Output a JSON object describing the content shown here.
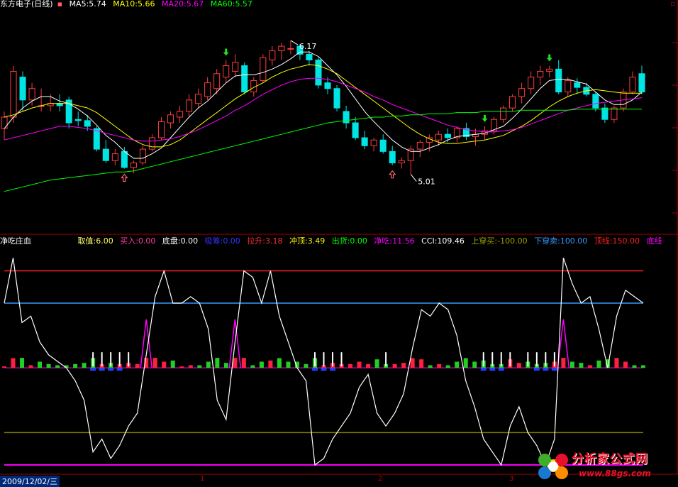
{
  "top_legend": {
    "title": "东方电子(日线)",
    "items": [
      {
        "label": "MA5:5.74",
        "color": "#ffffff"
      },
      {
        "label": "MA10:5.66",
        "color": "#ffff00"
      },
      {
        "label": "MA20:5.67",
        "color": "#ff00ff"
      },
      {
        "label": "MA60:5.57",
        "color": "#00ff00"
      }
    ]
  },
  "indicator_legend": {
    "title": "净吃庄血",
    "items": [
      {
        "label": "取值:6.00",
        "color": "#ffff66"
      },
      {
        "label": "买入:0.00",
        "color": "#ff3fa0"
      },
      {
        "label": "底盘:0.00",
        "color": "#ffffff"
      },
      {
        "label": "吸筹:0.00",
        "color": "#3333ff"
      },
      {
        "label": "拉升:3.18",
        "color": "#ff3030"
      },
      {
        "label": "冲顶:3.49",
        "color": "#ffff00"
      },
      {
        "label": "出货:0.00",
        "color": "#00ff00"
      },
      {
        "label": "净吃:11.56",
        "color": "#ff00ff"
      },
      {
        "label": "CCI:109.46",
        "color": "#ffffff"
      },
      {
        "label": "上穿买:-100.00",
        "color": "#808000"
      },
      {
        "label": "下穿卖:100.00",
        "color": "#3399ff"
      },
      {
        "label": "顶线:150.00",
        "color": "#ff2020"
      },
      {
        "label": "底线",
        "color": "#ff00ff"
      }
    ]
  },
  "footer": {
    "date": "2009/12/02/三",
    "month_marks": [
      "1",
      "2",
      "3"
    ]
  },
  "logo": {
    "name": "分析家公式网",
    "url": "www.88gs.com"
  },
  "chart_data": [
    {
      "type": "candlestick",
      "title": "东方电子(日线)",
      "annotations": [
        {
          "label": "6.17",
          "kind": "high"
        },
        {
          "label": "5.01",
          "kind": "low"
        }
      ],
      "ylim": [
        4.6,
        6.4
      ],
      "candles": [
        [
          5.4,
          5.55,
          5.3,
          5.5
        ],
        [
          5.5,
          5.95,
          5.45,
          5.9
        ],
        [
          5.85,
          5.9,
          5.55,
          5.65
        ],
        [
          5.65,
          5.8,
          5.6,
          5.75
        ],
        [
          5.6,
          5.75,
          5.55,
          5.6
        ],
        [
          5.6,
          5.7,
          5.55,
          5.62
        ],
        [
          5.62,
          5.7,
          5.55,
          5.6
        ],
        [
          5.65,
          5.68,
          5.4,
          5.45
        ],
        [
          5.48,
          5.55,
          5.42,
          5.47
        ],
        [
          5.47,
          5.52,
          5.38,
          5.42
        ],
        [
          5.4,
          5.42,
          5.2,
          5.22
        ],
        [
          5.22,
          5.3,
          5.1,
          5.12
        ],
        [
          5.12,
          5.22,
          5.08,
          5.18
        ],
        [
          5.2,
          5.24,
          5.05,
          5.06
        ],
        [
          5.06,
          5.12,
          5.01,
          5.1
        ],
        [
          5.1,
          5.25,
          5.08,
          5.22
        ],
        [
          5.22,
          5.35,
          5.2,
          5.32
        ],
        [
          5.32,
          5.5,
          5.3,
          5.46
        ],
        [
          5.45,
          5.55,
          5.4,
          5.52
        ],
        [
          5.5,
          5.6,
          5.45,
          5.55
        ],
        [
          5.55,
          5.7,
          5.5,
          5.65
        ],
        [
          5.62,
          5.75,
          5.58,
          5.7
        ],
        [
          5.68,
          5.85,
          5.65,
          5.8
        ],
        [
          5.75,
          5.92,
          5.7,
          5.88
        ],
        [
          5.85,
          6.0,
          5.8,
          5.95
        ],
        [
          5.9,
          6.05,
          5.85,
          5.98
        ],
        [
          5.95,
          5.98,
          5.7,
          5.72
        ],
        [
          5.72,
          5.85,
          5.68,
          5.82
        ],
        [
          5.82,
          6.05,
          5.8,
          6.02
        ],
        [
          6.0,
          6.12,
          5.95,
          6.08
        ],
        [
          6.08,
          6.15,
          6.0,
          6.12
        ],
        [
          6.1,
          6.17,
          6.05,
          6.1
        ],
        [
          6.12,
          6.14,
          6.0,
          6.05
        ],
        [
          6.05,
          6.08,
          5.95,
          6.0
        ],
        [
          6.0,
          6.02,
          5.75,
          5.78
        ],
        [
          5.8,
          5.85,
          5.7,
          5.75
        ],
        [
          5.75,
          5.78,
          5.55,
          5.58
        ],
        [
          5.55,
          5.6,
          5.4,
          5.45
        ],
        [
          5.45,
          5.5,
          5.3,
          5.32
        ],
        [
          5.32,
          5.38,
          5.22,
          5.25
        ],
        [
          5.25,
          5.32,
          5.2,
          5.3
        ],
        [
          5.3,
          5.35,
          5.18,
          5.2
        ],
        [
          5.2,
          5.25,
          5.08,
          5.1
        ],
        [
          5.1,
          5.15,
          5.05,
          5.12
        ],
        [
          5.12,
          5.25,
          5.0,
          5.22
        ],
        [
          5.22,
          5.3,
          5.15,
          5.28
        ],
        [
          5.28,
          5.35,
          5.2,
          5.32
        ],
        [
          5.3,
          5.38,
          5.25,
          5.35
        ],
        [
          5.35,
          5.4,
          5.28,
          5.32
        ],
        [
          5.32,
          5.42,
          5.28,
          5.4
        ],
        [
          5.4,
          5.45,
          5.3,
          5.33
        ],
        [
          5.33,
          5.4,
          5.25,
          5.35
        ],
        [
          5.35,
          5.42,
          5.3,
          5.38
        ],
        [
          5.38,
          5.5,
          5.35,
          5.48
        ],
        [
          5.48,
          5.6,
          5.45,
          5.58
        ],
        [
          5.58,
          5.7,
          5.55,
          5.68
        ],
        [
          5.68,
          5.8,
          5.62,
          5.75
        ],
        [
          5.75,
          5.9,
          5.7,
          5.85
        ],
        [
          5.85,
          5.95,
          5.78,
          5.9
        ],
        [
          5.9,
          5.95,
          5.85,
          5.92
        ],
        [
          5.92,
          6.0,
          5.7,
          5.72
        ],
        [
          5.72,
          5.85,
          5.68,
          5.82
        ],
        [
          5.8,
          5.84,
          5.7,
          5.76
        ],
        [
          5.76,
          5.8,
          5.68,
          5.7
        ],
        [
          5.7,
          5.72,
          5.55,
          5.58
        ],
        [
          5.58,
          5.62,
          5.45,
          5.48
        ],
        [
          5.48,
          5.6,
          5.45,
          5.58
        ],
        [
          5.58,
          5.75,
          5.55,
          5.72
        ],
        [
          5.72,
          5.9,
          5.7,
          5.85
        ],
        [
          5.88,
          5.95,
          5.7,
          5.72
        ]
      ],
      "ma": [
        {
          "name": "MA5",
          "color": "#ffffff",
          "values": [
            5.4,
            5.5,
            5.58,
            5.64,
            5.68,
            5.68,
            5.64,
            5.62,
            5.57,
            5.51,
            5.43,
            5.34,
            5.28,
            5.2,
            5.14,
            5.14,
            5.18,
            5.23,
            5.32,
            5.41,
            5.5,
            5.58,
            5.64,
            5.72,
            5.8,
            5.86,
            5.87,
            5.87,
            5.89,
            5.92,
            5.96,
            6.01,
            6.07,
            6.07,
            6.03,
            5.95,
            5.87,
            5.77,
            5.66,
            5.55,
            5.46,
            5.38,
            5.3,
            5.24,
            5.2,
            5.2,
            5.23,
            5.26,
            5.3,
            5.33,
            5.34,
            5.35,
            5.36,
            5.39,
            5.42,
            5.49,
            5.57,
            5.66,
            5.75,
            5.82,
            5.83,
            5.83,
            5.81,
            5.79,
            5.72,
            5.65,
            5.61,
            5.61,
            5.65,
            5.72
          ]
        },
        {
          "name": "MA10",
          "color": "#ffff00",
          "values": [
            5.5,
            5.52,
            5.55,
            5.58,
            5.6,
            5.62,
            5.62,
            5.62,
            5.6,
            5.58,
            5.54,
            5.48,
            5.42,
            5.36,
            5.3,
            5.26,
            5.24,
            5.24,
            5.26,
            5.3,
            5.36,
            5.42,
            5.48,
            5.54,
            5.6,
            5.66,
            5.71,
            5.76,
            5.8,
            5.85,
            5.89,
            5.92,
            5.94,
            5.96,
            5.95,
            5.92,
            5.88,
            5.82,
            5.76,
            5.7,
            5.64,
            5.58,
            5.52,
            5.46,
            5.4,
            5.35,
            5.31,
            5.28,
            5.27,
            5.27,
            5.28,
            5.29,
            5.3,
            5.32,
            5.34,
            5.38,
            5.42,
            5.47,
            5.53,
            5.59,
            5.64,
            5.68,
            5.71,
            5.73,
            5.74,
            5.73,
            5.72,
            5.71,
            5.71,
            5.71
          ]
        },
        {
          "name": "MA20",
          "color": "#ff00ff",
          "values": [
            5.3,
            5.32,
            5.34,
            5.36,
            5.38,
            5.4,
            5.42,
            5.42,
            5.41,
            5.4,
            5.38,
            5.36,
            5.34,
            5.32,
            5.3,
            5.29,
            5.29,
            5.3,
            5.31,
            5.33,
            5.36,
            5.39,
            5.43,
            5.47,
            5.51,
            5.56,
            5.6,
            5.65,
            5.7,
            5.74,
            5.78,
            5.81,
            5.83,
            5.84,
            5.84,
            5.83,
            5.81,
            5.78,
            5.75,
            5.72,
            5.68,
            5.65,
            5.61,
            5.58,
            5.55,
            5.52,
            5.49,
            5.46,
            5.43,
            5.41,
            5.39,
            5.38,
            5.37,
            5.37,
            5.38,
            5.39,
            5.41,
            5.44,
            5.47,
            5.5,
            5.53,
            5.56,
            5.58,
            5.6,
            5.62,
            5.63,
            5.64,
            5.65,
            5.66,
            5.67
          ]
        },
        {
          "name": "MA60",
          "color": "#00ff00",
          "values": [
            4.85,
            4.87,
            4.89,
            4.91,
            4.93,
            4.95,
            4.96,
            4.97,
            4.98,
            4.99,
            5.0,
            5.01,
            5.02,
            5.02,
            5.03,
            5.05,
            5.07,
            5.09,
            5.11,
            5.13,
            5.15,
            5.17,
            5.19,
            5.21,
            5.23,
            5.25,
            5.27,
            5.29,
            5.31,
            5.33,
            5.35,
            5.37,
            5.39,
            5.41,
            5.43,
            5.45,
            5.46,
            5.47,
            5.48,
            5.49,
            5.5,
            5.5,
            5.51,
            5.51,
            5.52,
            5.52,
            5.53,
            5.53,
            5.53,
            5.54,
            5.54,
            5.54,
            5.55,
            5.55,
            5.55,
            5.55,
            5.56,
            5.56,
            5.56,
            5.56,
            5.56,
            5.56,
            5.57,
            5.57,
            5.57,
            5.57,
            5.57,
            5.57,
            5.57,
            5.57
          ]
        }
      ],
      "buy_arrows": [
        13,
        42,
        70
      ],
      "sell_arrows": [
        24,
        59,
        52
      ]
    },
    {
      "type": "line",
      "title": "净吃庄血",
      "ylim": [
        -160,
        190
      ],
      "reference_lines": [
        {
          "name": "顶线",
          "value": 150,
          "color": "#ff2020"
        },
        {
          "name": "下穿卖",
          "value": 100,
          "color": "#3399ff"
        },
        {
          "name": "上穿买",
          "value": -100,
          "color": "#808000"
        },
        {
          "name": "底线",
          "value": -150,
          "color": "#ff00ff"
        }
      ],
      "zero_line_color": "#ff00ff",
      "cci": [
        100,
        170,
        70,
        80,
        40,
        20,
        10,
        0,
        -20,
        -50,
        -130,
        -110,
        -140,
        -120,
        -90,
        -70,
        20,
        110,
        150,
        100,
        100,
        110,
        100,
        60,
        -50,
        -80,
        40,
        150,
        140,
        100,
        150,
        80,
        40,
        0,
        -20,
        -150,
        -140,
        -110,
        -90,
        -70,
        -30,
        -10,
        -70,
        -90,
        -70,
        -40,
        30,
        90,
        80,
        100,
        90,
        50,
        -20,
        -60,
        -110,
        -130,
        -150,
        -90,
        -60,
        -100,
        -120,
        -150,
        -110,
        170,
        130,
        100,
        110,
        60,
        0,
        80,
        120,
        110,
        100
      ]
    }
  ]
}
